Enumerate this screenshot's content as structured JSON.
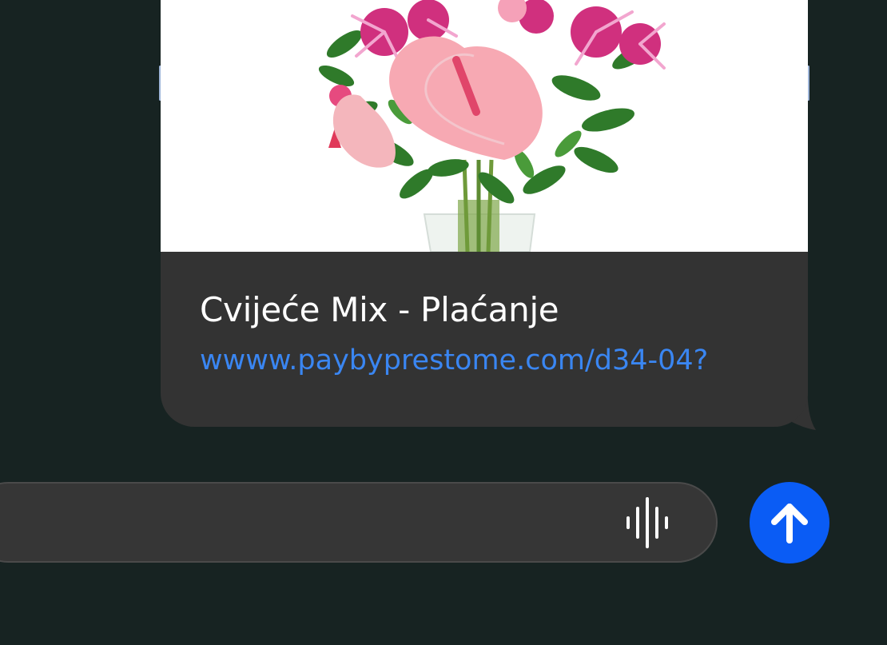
{
  "message": {
    "link_preview": {
      "image": "flower-bouquet",
      "title": "Cvijeće Mix - Plaćanje",
      "url": "wwww.paybyprestome.com/d34-04?"
    }
  },
  "composer": {
    "input_value": "",
    "audio_icon": "waveform-icon",
    "send_icon": "arrow-up-icon"
  },
  "colors": {
    "background": "#172322",
    "bubble": "#333333",
    "link": "#3a86f2",
    "send": "#0a5cf5"
  }
}
